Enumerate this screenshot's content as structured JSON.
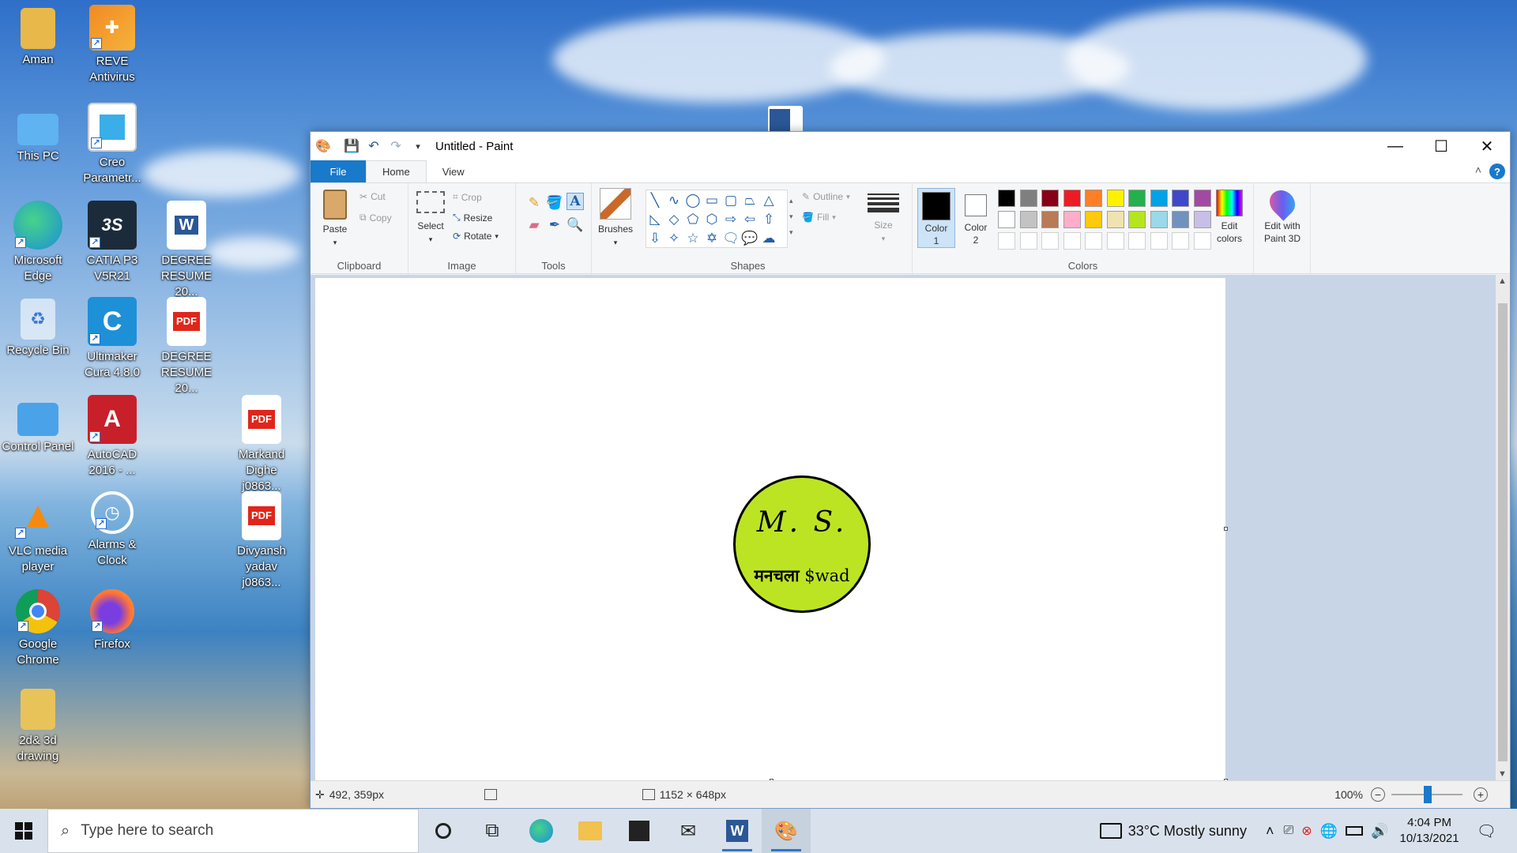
{
  "desktop": {
    "icons": [
      {
        "label": "Aman",
        "icon": "folder-icon"
      },
      {
        "label": "REVE Antivirus",
        "icon": "reve-antivirus-icon"
      },
      {
        "label": "This PC",
        "icon": "this-pc-icon"
      },
      {
        "label": "Creo Parametr...",
        "icon": "creo-icon"
      },
      {
        "label": "Microsoft Edge",
        "icon": "edge-icon"
      },
      {
        "label": "CATIA P3 V5R21",
        "icon": "catia-icon"
      },
      {
        "label": "DEGREE RESUME 20...",
        "icon": "word-doc-icon"
      },
      {
        "label": "Recycle Bin",
        "icon": "recycle-bin-icon"
      },
      {
        "label": "Ultimaker Cura 4.8.0",
        "icon": "cura-icon"
      },
      {
        "label": "DEGREE RESUME 20...",
        "icon": "pdf-icon"
      },
      {
        "label": "Control Panel",
        "icon": "control-panel-icon"
      },
      {
        "label": "AutoCAD 2016 - ...",
        "icon": "autocad-icon"
      },
      {
        "label": "Markand Dighe j0863...",
        "icon": "pdf-icon"
      },
      {
        "label": "VLC media player",
        "icon": "vlc-icon"
      },
      {
        "label": "Alarms & Clock",
        "icon": "alarms-clock-icon"
      },
      {
        "label": "Divyansh yadav j0863...",
        "icon": "pdf-icon"
      },
      {
        "label": "Google Chrome",
        "icon": "chrome-icon"
      },
      {
        "label": "Firefox",
        "icon": "firefox-icon"
      },
      {
        "label": "2d& 3d drawing",
        "icon": "folder-icon"
      }
    ],
    "pdf_text": "PDF"
  },
  "window": {
    "title": "Untitled - Paint",
    "tabs": {
      "file": "File",
      "home": "Home",
      "view": "View"
    },
    "help": "?"
  },
  "ribbon": {
    "clipboard": {
      "label": "Clipboard",
      "paste": "Paste",
      "cut": "Cut",
      "copy": "Copy"
    },
    "image": {
      "label": "Image",
      "select": "Select",
      "crop": "Crop",
      "resize": "Resize",
      "rotate": "Rotate"
    },
    "tools": {
      "label": "Tools"
    },
    "brushes": {
      "label": "Brushes"
    },
    "shapes": {
      "label": "Shapes",
      "outline": "Outline",
      "fill": "Fill"
    },
    "size": {
      "label": "Size"
    },
    "color1": {
      "label": "Color",
      "sub": "1",
      "value": "#000000"
    },
    "color2": {
      "label": "Color",
      "sub": "2",
      "value": "#ffffff"
    },
    "colors": {
      "label": "Colors"
    },
    "edit_colors": {
      "line1": "Edit",
      "line2": "colors"
    },
    "paint3d": {
      "line1": "Edit with",
      "line2": "Paint 3D"
    },
    "palette_row1": [
      "#000000",
      "#7f7f7f",
      "#880015",
      "#ed1c24",
      "#ff7f27",
      "#fff200",
      "#22b14c",
      "#00a2e8",
      "#3f48cc",
      "#a349a4"
    ],
    "palette_row2": [
      "#ffffff",
      "#c3c3c3",
      "#b97a57",
      "#ffaec9",
      "#ffc90e",
      "#efe4b0",
      "#b5e61d",
      "#99d9ea",
      "#7092be",
      "#c8bfe7"
    ]
  },
  "canvas": {
    "logo": {
      "initials": "M. S.",
      "hindi": "मनचला",
      "tag": "$wad",
      "fill": "#bde423"
    }
  },
  "status": {
    "cursor": "492, 359px",
    "canvas_size": "1152 × 648px",
    "zoom": "100%"
  },
  "taskbar": {
    "search_placeholder": "Type here to search",
    "weather": "33°C  Mostly sunny",
    "time": "4:04 PM",
    "date": "10/13/2021"
  }
}
